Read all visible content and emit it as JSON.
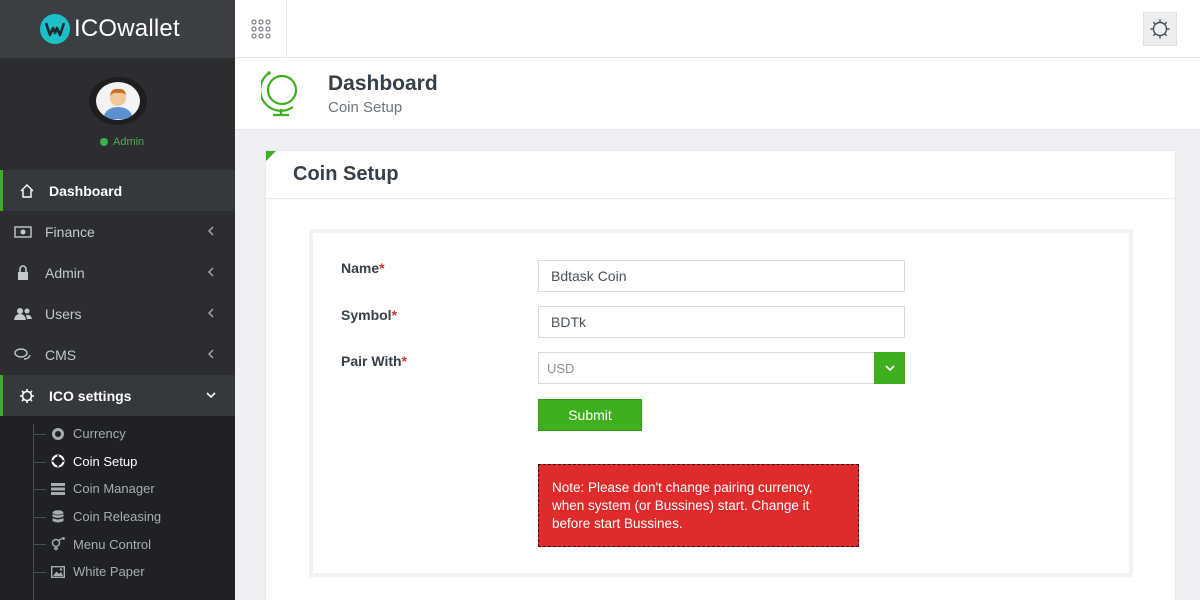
{
  "brand": {
    "name": "ICOwallet"
  },
  "profile": {
    "role": "Admin"
  },
  "sidebar": {
    "items": [
      {
        "label": "Dashboard"
      },
      {
        "label": "Finance"
      },
      {
        "label": "Admin"
      },
      {
        "label": "Users"
      },
      {
        "label": "CMS"
      },
      {
        "label": "ICO settings"
      }
    ],
    "submenu": [
      {
        "label": "Currency"
      },
      {
        "label": "Coin Setup"
      },
      {
        "label": "Coin Manager"
      },
      {
        "label": "Coin Releasing"
      },
      {
        "label": "Menu Control"
      },
      {
        "label": "White Paper"
      }
    ]
  },
  "page_header": {
    "title": "Dashboard",
    "subtitle": "Coin Setup"
  },
  "card": {
    "title": "Coin Setup"
  },
  "form": {
    "name_label": "Name",
    "name_value": "Bdtask Coin",
    "symbol_label": "Symbol",
    "symbol_value": "BDTk",
    "pair_label": "Pair With",
    "pair_value": "USD",
    "required_mark": "*",
    "submit_label": "Submit",
    "note": "Note: Please don't change pairing currency, when system (or Bussines) start. Change it before start Bussines."
  },
  "colors": {
    "accent": "#3fae1f",
    "sidebar": "#2b2d30",
    "alert": "#df2b2b",
    "brand_logo": "#1ec0c8"
  }
}
